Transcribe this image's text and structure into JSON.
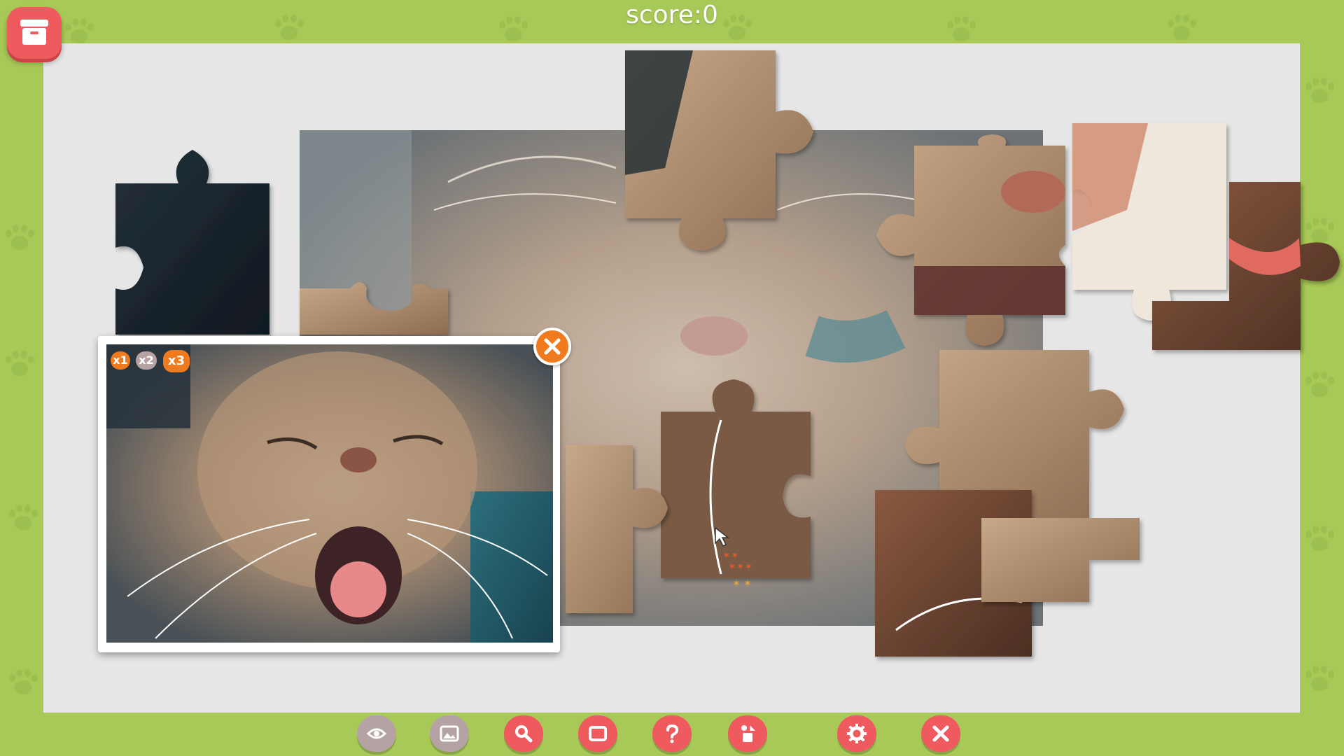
{
  "hud": {
    "score": "score:0"
  },
  "colors": {
    "frame": "#a8c957",
    "board": "#e6e6e6",
    "accent_red": "#ef5a5f",
    "accent_orange": "#f07a1e",
    "disabled_gray": "#b5a3a3"
  },
  "preview": {
    "multipliers": [
      "x1",
      "x2",
      "x3"
    ]
  },
  "toolbar": [
    {
      "name": "preview-eye-button",
      "icon": "eye-icon",
      "state": "disabled"
    },
    {
      "name": "background-image-button",
      "icon": "image-icon",
      "state": "disabled"
    },
    {
      "name": "zoom-button",
      "icon": "magnifier-icon",
      "state": "active"
    },
    {
      "name": "window-button",
      "icon": "square-icon",
      "state": "active"
    },
    {
      "name": "help-button",
      "icon": "question-icon",
      "state": "active"
    },
    {
      "name": "scatter-pieces-button",
      "icon": "shapes-icon",
      "state": "active"
    },
    {
      "name": "settings-button",
      "icon": "gear-icon",
      "state": "active"
    },
    {
      "name": "exit-button",
      "icon": "close-icon",
      "state": "active"
    }
  ],
  "piece_box": {
    "icon": "box-icon"
  }
}
